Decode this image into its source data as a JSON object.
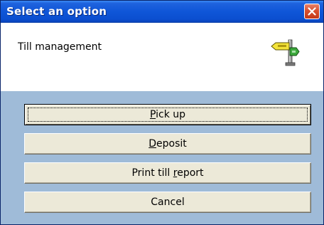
{
  "window": {
    "title": "Select an option",
    "close_icon": "close-x-icon"
  },
  "header": {
    "message": "Till management",
    "icon": "signpost-icon"
  },
  "buttons": [
    {
      "label": "Pick up",
      "pre": "",
      "mnemonic": "P",
      "post": "ick up",
      "focused": true
    },
    {
      "label": "Deposit",
      "pre": "",
      "mnemonic": "D",
      "post": "eposit",
      "focused": false
    },
    {
      "label": "Print till report",
      "pre": "Print till ",
      "mnemonic": "r",
      "post": "eport",
      "focused": false
    },
    {
      "label": "Cancel",
      "pre": "Cancel",
      "mnemonic": "",
      "post": "",
      "focused": false
    }
  ],
  "colors": {
    "titlebar": "#0f56d8",
    "button_area": "#9fbbd8",
    "button_face": "#ece9d8",
    "close_button": "#d8502f"
  }
}
